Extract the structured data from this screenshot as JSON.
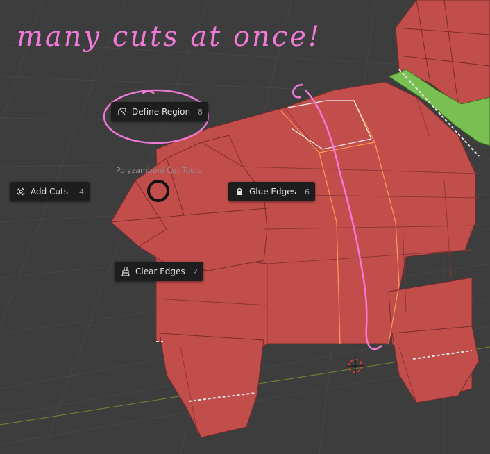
{
  "annotation": {
    "text": "many cuts at once!",
    "color": "#f07ad8"
  },
  "pie_menu": {
    "title": "Polyzamboni Cut Tools",
    "items": [
      {
        "id": "define-region",
        "label": "Define Region",
        "shortcut": "8",
        "icon": "region-select-icon"
      },
      {
        "id": "add-cuts",
        "label": "Add Cuts",
        "shortcut": "4",
        "icon": "add-cuts-icon"
      },
      {
        "id": "glue-edges",
        "label": "Glue Edges",
        "shortcut": "6",
        "icon": "lock-icon"
      },
      {
        "id": "clear-edges",
        "label": "Clear Edges",
        "shortcut": "2",
        "icon": "brush-icon"
      }
    ]
  },
  "colors": {
    "viewport_bg": "#3d3d3d",
    "grid": "#474747",
    "mesh_face": "#c24e4c",
    "mesh_edge": "#7a2a2a",
    "selected_face": "#79bf52",
    "cut_edge": "#ff9a55",
    "menu_bg": "#1d1d1d",
    "menu_text": "#e0e0e0"
  }
}
